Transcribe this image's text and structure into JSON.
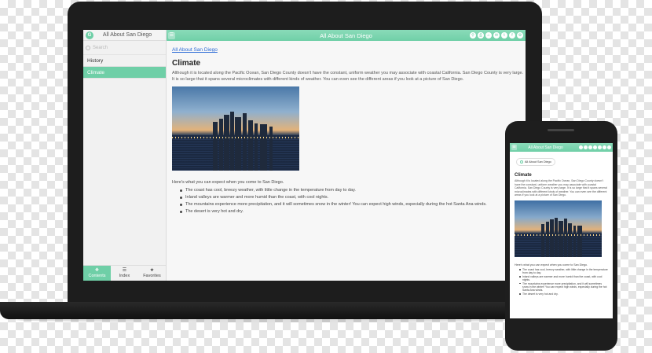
{
  "colors": {
    "accent": "#6fcfa7",
    "link": "#2a6ad6",
    "device": "#1d1d1d"
  },
  "app": {
    "title": "All About San Diego",
    "logo_letter": "G"
  },
  "sidebar": {
    "search_placeholder": "Search",
    "items": [
      {
        "label": "History",
        "active": false
      },
      {
        "label": "Climate",
        "active": true
      }
    ],
    "footer_tabs": [
      {
        "label": "Contents",
        "icon": "bookmark-icon",
        "active": true
      },
      {
        "label": "Index",
        "icon": "list-icon",
        "active": false
      },
      {
        "label": "Favorites",
        "icon": "star-icon",
        "active": false
      }
    ]
  },
  "toolbar": {
    "menu_icon": "hamburger-icon",
    "icons": [
      "search-icon",
      "print-icon",
      "home-icon",
      "email-icon",
      "twitter-icon",
      "facebook-icon",
      "settings-icon"
    ]
  },
  "page": {
    "breadcrumb": "All About San Diego",
    "heading": "Climate",
    "paragraph": "Although it is located along the Pacific Ocean, San Diego County doesn't have the constant, uniform weather you may associate with coastal California. San Diego County is very large. It is so large that it spans several microclimates with different kinds of weather. You can even see the different areas if you look at a picture of San Diego.",
    "intro": "Here's what you can expect when you come to San Diego.",
    "bullets": [
      "The coast has cool, breezy weather, with little change in the temperature from day to day.",
      "Inland valleys are warmer and more humid than the coast, with cool nights.",
      "The mountains experience more precipitation, and it will sometimes snow in the winter! You can expect high winds, especially during the hot Santa Ana winds.",
      "The desert is very hot and dry."
    ]
  },
  "phone_bullets": [
    "The coast has cool, breezy weather, with little change in the temperature from day to day.",
    "Inland valleys are warmer and more humid than the coast, with cool nights.",
    "The mountains experience more precipitation, and it will sometimes snow in the winter! You can expect high winds, especially during the hot Santa Ana winds.",
    "The desert is very hot and dry."
  ]
}
